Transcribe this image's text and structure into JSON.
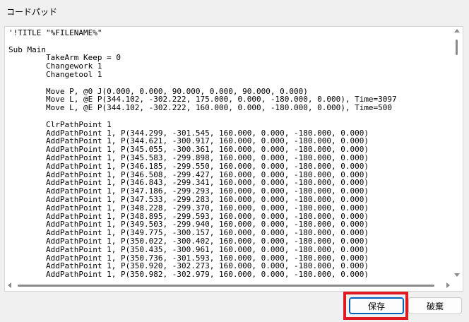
{
  "window": {
    "title": "コードパッド"
  },
  "code_lines": [
    "'!TITLE \"%FILENAME%\"",
    "",
    "Sub Main",
    "\tTakeArm Keep = 0",
    "\tChangework 1",
    "\tChangetool 1",
    "",
    "\tMove P, @0 J(0.000, 0.000, 90.000, 0.000, 90.000, 0.000)",
    "\tMove L, @E P(344.102, -302.222, 175.000, 0.000, -180.000, 0.000), Time=3097",
    "\tMove L, @E P(344.102, -302.222, 160.000, 0.000, -180.000, 0.000), Time=500",
    "",
    "\tClrPathPoint 1",
    "\tAddPathPoint 1, P(344.299, -301.545, 160.000, 0.000, -180.000, 0.000)",
    "\tAddPathPoint 1, P(344.621, -300.917, 160.000, 0.000, -180.000, 0.000)",
    "\tAddPathPoint 1, P(345.055, -300.361, 160.000, 0.000, -180.000, 0.000)",
    "\tAddPathPoint 1, P(345.583, -299.898, 160.000, 0.000, -180.000, 0.000)",
    "\tAddPathPoint 1, P(346.185, -299.550, 160.000, 0.000, -180.000, 0.000)",
    "\tAddPathPoint 1, P(346.508, -299.427, 160.000, 0.000, -180.000, 0.000)",
    "\tAddPathPoint 1, P(346.843, -299.341, 160.000, 0.000, -180.000, 0.000)",
    "\tAddPathPoint 1, P(347.186, -299.293, 160.000, 0.000, -180.000, 0.000)",
    "\tAddPathPoint 1, P(347.533, -299.283, 160.000, 0.000, -180.000, 0.000)",
    "\tAddPathPoint 1, P(348.228, -299.370, 160.000, 0.000, -180.000, 0.000)",
    "\tAddPathPoint 1, P(348.895, -299.593, 160.000, 0.000, -180.000, 0.000)",
    "\tAddPathPoint 1, P(349.503, -299.940, 160.000, 0.000, -180.000, 0.000)",
    "\tAddPathPoint 1, P(349.775, -300.157, 160.000, 0.000, -180.000, 0.000)",
    "\tAddPathPoint 1, P(350.022, -300.402, 160.000, 0.000, -180.000, 0.000)",
    "\tAddPathPoint 1, P(350.435, -300.961, 160.000, 0.000, -180.000, 0.000)",
    "\tAddPathPoint 1, P(350.736, -301.593, 160.000, 0.000, -180.000, 0.000)",
    "\tAddPathPoint 1, P(350.920, -302.273, 160.000, 0.000, -180.000, 0.000)",
    "\tAddPathPoint 1, P(350.982, -302.979, 160.000, 0.000, -180.000, 0.000)"
  ],
  "buttons": {
    "save": "保存",
    "discard": "破棄"
  },
  "colors": {
    "highlight": "#e01a22",
    "focus_border": "#005fb8"
  }
}
